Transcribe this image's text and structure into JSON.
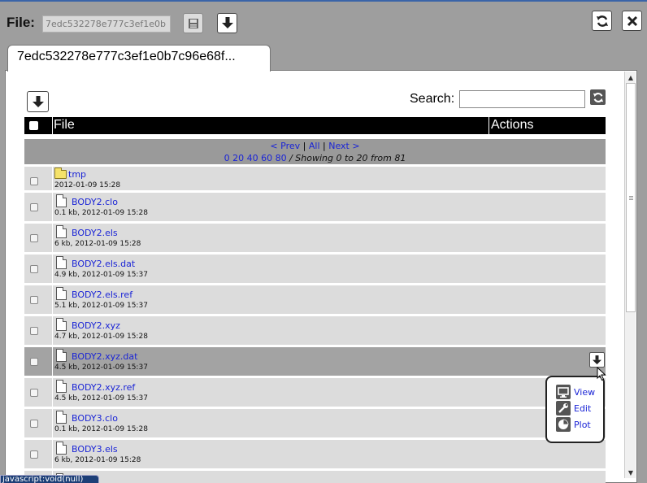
{
  "header": {
    "file_label": "File:",
    "file_value": "7edc532278e777c3ef1e0b",
    "save_icon": "floppy-icon",
    "download_icon": "download-arrow-icon",
    "refresh_icon": "refresh-icon",
    "close_icon": "close-icon"
  },
  "tab": {
    "label": "7edc532278e777c3ef1e0b7c96e68f..."
  },
  "toolbar": {
    "search_label": "Search:",
    "search_value": "",
    "refresh_icon": "refresh-icon",
    "download_icon": "download-arrow-icon"
  },
  "table": {
    "headers": {
      "file": "File",
      "actions": "Actions"
    },
    "pager": {
      "prev": "< Prev",
      "all": "All",
      "next": "Next >",
      "sep": "|",
      "pages": [
        "0",
        "20",
        "40",
        "60",
        "80"
      ],
      "showing": "/ Showing 0 to 20 from 81"
    },
    "rows": [
      {
        "name": "tmp",
        "meta": "2012-01-09 15:28",
        "kind": "folder"
      },
      {
        "name": "BODY2.clo",
        "meta": "0.1 kb, 2012-01-09 15:28",
        "kind": "file"
      },
      {
        "name": "BODY2.els",
        "meta": "6 kb, 2012-01-09 15:28",
        "kind": "file"
      },
      {
        "name": "BODY2.els.dat",
        "meta": "4.9 kb, 2012-01-09 15:37",
        "kind": "file"
      },
      {
        "name": "BODY2.els.ref",
        "meta": "5.1 kb, 2012-01-09 15:37",
        "kind": "file"
      },
      {
        "name": "BODY2.xyz",
        "meta": "4.7 kb, 2012-01-09 15:28",
        "kind": "file"
      },
      {
        "name": "BODY2.xyz.dat",
        "meta": "4.5 kb, 2012-01-09 15:37",
        "kind": "file",
        "hover": true
      },
      {
        "name": "BODY2.xyz.ref",
        "meta": "4.5 kb, 2012-01-09 15:37",
        "kind": "file"
      },
      {
        "name": "BODY3.clo",
        "meta": "0.1 kb, 2012-01-09 15:28",
        "kind": "file"
      },
      {
        "name": "BODY3.els",
        "meta": "6 kb, 2012-01-09 15:28",
        "kind": "file"
      }
    ]
  },
  "actions_menu": {
    "items": [
      {
        "label": "View",
        "icon": "monitor-icon"
      },
      {
        "label": "Edit",
        "icon": "wrench-icon"
      },
      {
        "label": "Plot",
        "icon": "pie-chart-icon"
      }
    ]
  },
  "statusbar": {
    "text": "javascript:void(null)"
  },
  "colors": {
    "window_bg": "#9e9e9e",
    "link": "#1a24d6",
    "row_bg": "#dcdcdc",
    "row_hover_bg": "#a3a3a3",
    "header_bg": "#000000",
    "status_bg": "#1d3f77"
  }
}
